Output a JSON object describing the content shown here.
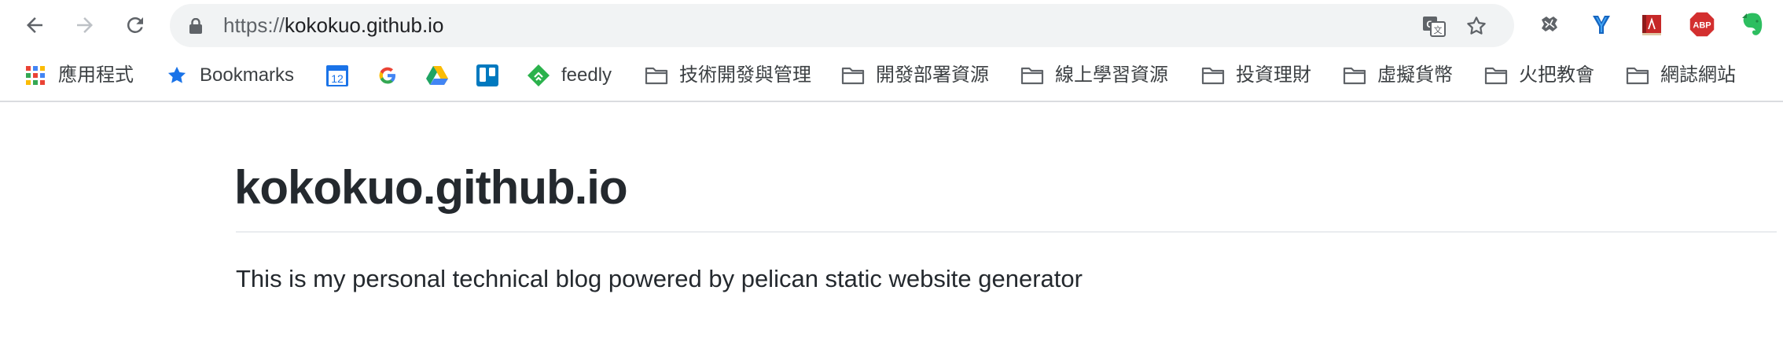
{
  "browser": {
    "url_scheme": "https://",
    "url_host": "kokokuo.github.io",
    "icons": {
      "back": "back-arrow-icon",
      "forward": "forward-arrow-icon",
      "reload": "reload-icon",
      "lock": "lock-icon",
      "translate": "translate-icon",
      "bookmark": "star-icon"
    },
    "extensions": [
      {
        "name": "puzzle-extension-icon"
      },
      {
        "name": "y-extension-icon"
      },
      {
        "name": "book-extension-icon"
      },
      {
        "name": "adblock-icon",
        "label": "ABP"
      },
      {
        "name": "evernote-icon"
      }
    ]
  },
  "bookmarks": [
    {
      "label": "應用程式",
      "icon": "apps-grid-icon"
    },
    {
      "label": "Bookmarks",
      "icon": "star-icon"
    },
    {
      "label": "",
      "icon": "calendar-icon",
      "badge": "12"
    },
    {
      "label": "",
      "icon": "google-icon"
    },
    {
      "label": "",
      "icon": "google-drive-icon"
    },
    {
      "label": "",
      "icon": "trello-icon"
    },
    {
      "label": "feedly",
      "icon": "feedly-icon"
    },
    {
      "label": "技術開發與管理",
      "icon": "folder-icon"
    },
    {
      "label": "開發部署資源",
      "icon": "folder-icon"
    },
    {
      "label": "線上學習資源",
      "icon": "folder-icon"
    },
    {
      "label": "投資理財",
      "icon": "folder-icon"
    },
    {
      "label": "虛擬貨幣",
      "icon": "folder-icon"
    },
    {
      "label": "火把教會",
      "icon": "folder-icon"
    },
    {
      "label": "網誌網站",
      "icon": "folder-icon"
    }
  ],
  "page": {
    "title": "kokokuo.github.io",
    "description": "This is my personal technical blog powered by pelican static website generator"
  },
  "colors": {
    "omnibox_bg": "#f1f3f4",
    "bookmark_star": "#1a73e8",
    "abp_red": "#d32f2f",
    "evernote_green": "#2dbe60",
    "text": "#24292e"
  }
}
